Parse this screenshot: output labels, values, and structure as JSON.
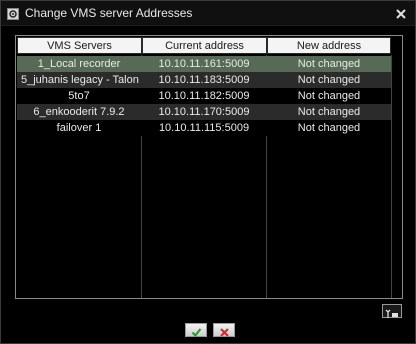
{
  "window": {
    "title": "Change VMS server Addresses",
    "title_icon": "settings-icon",
    "close_icon": "close-icon"
  },
  "table": {
    "columns": [
      "VMS Servers",
      "Current address",
      "New address"
    ],
    "rows": [
      {
        "server": "1_Local recorder",
        "current": "10.10.11.161:5009",
        "new": "Not changed"
      },
      {
        "server": "5_juhanis legacy - Talon ...",
        "current": "10.10.11.183:5009",
        "new": "Not changed"
      },
      {
        "server": "5to7",
        "current": "10.10.11.182:5009",
        "new": "Not changed"
      },
      {
        "server": "6_enkooderit 7.9.2",
        "current": "10.10.11.170:5009",
        "new": "Not changed"
      },
      {
        "server": "failover 1",
        "current": "10.10.11.115:5009",
        "new": "Not changed"
      }
    ],
    "selected_row": 0
  },
  "buttons": {
    "tool_icon": "column-settings-icon",
    "ok_icon": "checkmark-icon",
    "cancel_icon": "cancel-x-icon"
  },
  "colors": {
    "selected_row": "#566a55",
    "alt_row": "#2b2b2b",
    "ok_green": "#2f9a2f",
    "cancel_red": "#d03030"
  }
}
